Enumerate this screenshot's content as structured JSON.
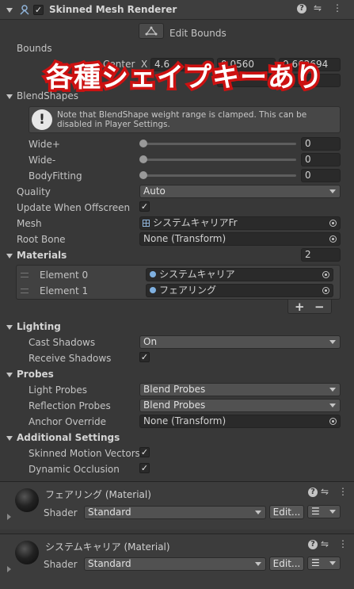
{
  "component": {
    "title": "Skinned Mesh Renderer",
    "edit_bounds": "Edit Bounds"
  },
  "bounds": {
    "label": "Bounds",
    "center_label": "Center",
    "x_label": "X",
    "x_value": "4.6",
    "y_value": "0.0560",
    "z_value": "0.662694"
  },
  "overlay": {
    "text": "各種シェイプキーあり"
  },
  "blendshapes": {
    "label": "BlendShapes",
    "note": "Note that BlendShape weight range is clamped. This can be disabled in Player Settings.",
    "items": [
      {
        "label": "Wide+",
        "value": "0",
        "level": 0
      },
      {
        "label": "Wide-",
        "value": "0",
        "level": 0
      },
      {
        "label": "BodyFitting",
        "value": "0",
        "level": 0
      }
    ]
  },
  "props": {
    "quality_label": "Quality",
    "quality_value": "Auto",
    "update_offscreen_label": "Update When Offscreen",
    "update_offscreen_checked": "✓",
    "mesh_label": "Mesh",
    "mesh_value": "システムキャリアFr",
    "root_bone_label": "Root Bone",
    "root_bone_value": "None (Transform)"
  },
  "materials": {
    "label": "Materials",
    "count": "2",
    "elements": [
      {
        "label": "Element 0",
        "value": "システムキャリア"
      },
      {
        "label": "Element 1",
        "value": "フェアリング"
      }
    ],
    "add": "+",
    "remove": "−"
  },
  "lighting": {
    "label": "Lighting",
    "cast_shadows_label": "Cast Shadows",
    "cast_shadows_value": "On",
    "receive_shadows_label": "Receive Shadows",
    "receive_shadows_checked": "✓"
  },
  "probes": {
    "label": "Probes",
    "light_probes_label": "Light Probes",
    "light_probes_value": "Blend Probes",
    "reflection_probes_label": "Reflection Probes",
    "reflection_probes_value": "Blend Probes",
    "anchor_override_label": "Anchor Override",
    "anchor_override_value": "None (Transform)"
  },
  "additional": {
    "label": "Additional Settings",
    "skinned_motion_label": "Skinned Motion Vectors",
    "skinned_motion_checked": "✓",
    "dynamic_occlusion_label": "Dynamic Occlusion",
    "dynamic_occlusion_checked": "✓"
  },
  "material_panels": [
    {
      "name": "フェアリング (Material)",
      "shader_label": "Shader",
      "shader_value": "Standard",
      "edit": "Edit..."
    },
    {
      "name": "システムキャリア (Material)",
      "shader_label": "Shader",
      "shader_value": "Standard",
      "edit": "Edit..."
    }
  ],
  "colors": {
    "background": "#383838",
    "overlay_fill": "#ffffff",
    "overlay_stroke": "#cc1111"
  }
}
